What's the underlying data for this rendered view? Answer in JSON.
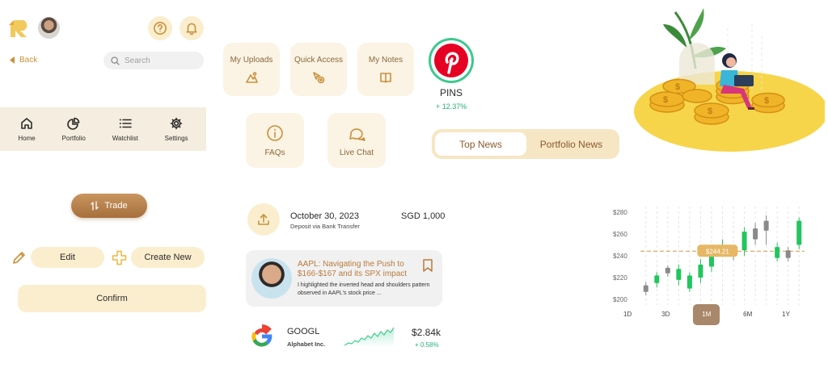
{
  "header": {
    "back_label": "Back",
    "search_placeholder": "Search"
  },
  "nav": {
    "items": [
      {
        "label": "Home",
        "icon": "home-icon"
      },
      {
        "label": "Portfolio",
        "icon": "pie-chart-icon"
      },
      {
        "label": "Watchlist",
        "icon": "list-icon"
      },
      {
        "label": "Settings",
        "icon": "gear-icon"
      }
    ]
  },
  "buttons": {
    "trade": "Trade",
    "edit": "Edit",
    "create_new": "Create New",
    "confirm": "Confirm"
  },
  "quick_cards": {
    "uploads": "My Uploads",
    "quick_access": "Quick Access",
    "notes": "My Notes",
    "faqs": "FAQs",
    "live_chat": "Live Chat"
  },
  "stock": {
    "ticker": "PINS",
    "change": "+ 12.37%",
    "brand_color": "#e60023"
  },
  "news_tabs": {
    "top": "Top News",
    "portfolio": "Portfolio News"
  },
  "transaction": {
    "date": "October 30, 2023",
    "desc": "Deposit via Bank Transfer",
    "amount": "SGD 1,000"
  },
  "news": {
    "title": "AAPL: Navigating the Push to $166-$167 and its SPX impact",
    "snippet": "I highlighted the inverted head and shoulders pattern observed in AAPL's stock price ..."
  },
  "googl": {
    "ticker": "GOOGL",
    "name": "Alphabet Inc.",
    "price": "$2.84k",
    "change": "+ 0.58%"
  },
  "chart": {
    "price_tag": "$244.21",
    "ranges": [
      "1D",
      "3D",
      "1M",
      "6M",
      "1Y"
    ],
    "selected_range": "1M"
  },
  "chart_data": {
    "type": "candlestick",
    "ylim": [
      195,
      285
    ],
    "yticks": [
      "$280",
      "$260",
      "$240",
      "$220",
      "$200"
    ],
    "yvalues": [
      280,
      260,
      240,
      220,
      200
    ],
    "reference_line": 244.21,
    "candles": [
      {
        "open": 207,
        "close": 213,
        "low": 204,
        "high": 216,
        "color": "gray"
      },
      {
        "open": 215,
        "close": 222,
        "low": 211,
        "high": 225,
        "color": "green"
      },
      {
        "open": 224,
        "close": 229,
        "low": 221,
        "high": 231,
        "color": "gray"
      },
      {
        "open": 218,
        "close": 228,
        "low": 213,
        "high": 232,
        "color": "green"
      },
      {
        "open": 222,
        "close": 210,
        "low": 207,
        "high": 225,
        "color": "green"
      },
      {
        "open": 220,
        "close": 232,
        "low": 215,
        "high": 237,
        "color": "green"
      },
      {
        "open": 230,
        "close": 245,
        "low": 225,
        "high": 250,
        "color": "green"
      },
      {
        "open": 245,
        "close": 250,
        "low": 242,
        "high": 255,
        "color": "green"
      },
      {
        "open": 240,
        "close": 247,
        "low": 236,
        "high": 250,
        "color": "gray"
      },
      {
        "open": 245,
        "close": 262,
        "low": 240,
        "high": 266,
        "color": "green"
      },
      {
        "open": 255,
        "close": 265,
        "low": 250,
        "high": 270,
        "color": "gray"
      },
      {
        "open": 263,
        "close": 272,
        "low": 250,
        "high": 277,
        "color": "gray"
      },
      {
        "open": 248,
        "close": 238,
        "low": 235,
        "high": 252,
        "color": "green"
      },
      {
        "open": 245,
        "close": 238,
        "low": 235,
        "high": 248,
        "color": "gray"
      },
      {
        "open": 250,
        "close": 272,
        "low": 246,
        "high": 275,
        "color": "green"
      }
    ]
  }
}
